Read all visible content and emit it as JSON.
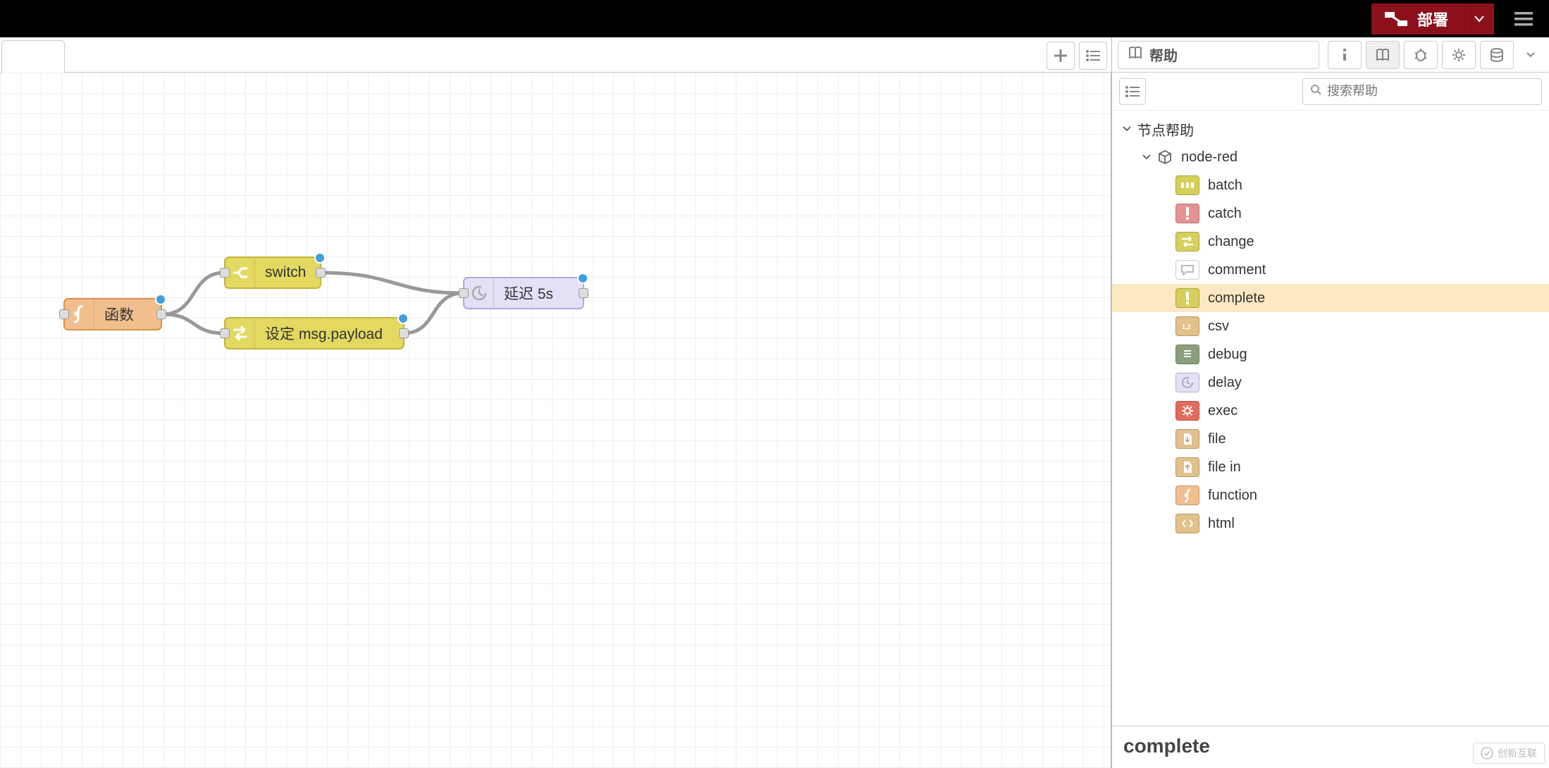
{
  "header": {
    "deploy_label": "部署"
  },
  "canvas": {
    "nodes": {
      "function": {
        "label": "函数"
      },
      "switch": {
        "label": "switch"
      },
      "change": {
        "label": "设定 msg.payload"
      },
      "delay": {
        "label": "延迟 5s"
      }
    }
  },
  "sidebar": {
    "title": "帮助",
    "search_placeholder": "搜索帮助",
    "tree": {
      "root_label": "节点帮助",
      "package_label": "node-red",
      "items": [
        {
          "label": "batch",
          "color": "#d6cf5a"
        },
        {
          "label": "catch",
          "color": "#e49292"
        },
        {
          "label": "change",
          "color": "#d6cf5a"
        },
        {
          "label": "comment",
          "color": "#ffffff"
        },
        {
          "label": "complete",
          "color": "#d6cf5a",
          "selected": true
        },
        {
          "label": "csv",
          "color": "#e2c18a"
        },
        {
          "label": "debug",
          "color": "#8b9e7a"
        },
        {
          "label": "delay",
          "color": "#e6e0f7"
        },
        {
          "label": "exec",
          "color": "#e36b5e"
        },
        {
          "label": "file",
          "color": "#e2c18a"
        },
        {
          "label": "file in",
          "color": "#e2c18a"
        },
        {
          "label": "function",
          "color": "#f1bf8e"
        },
        {
          "label": "html",
          "color": "#e2c18a"
        }
      ]
    },
    "detail_title": "complete"
  },
  "watermark": "创新互联"
}
